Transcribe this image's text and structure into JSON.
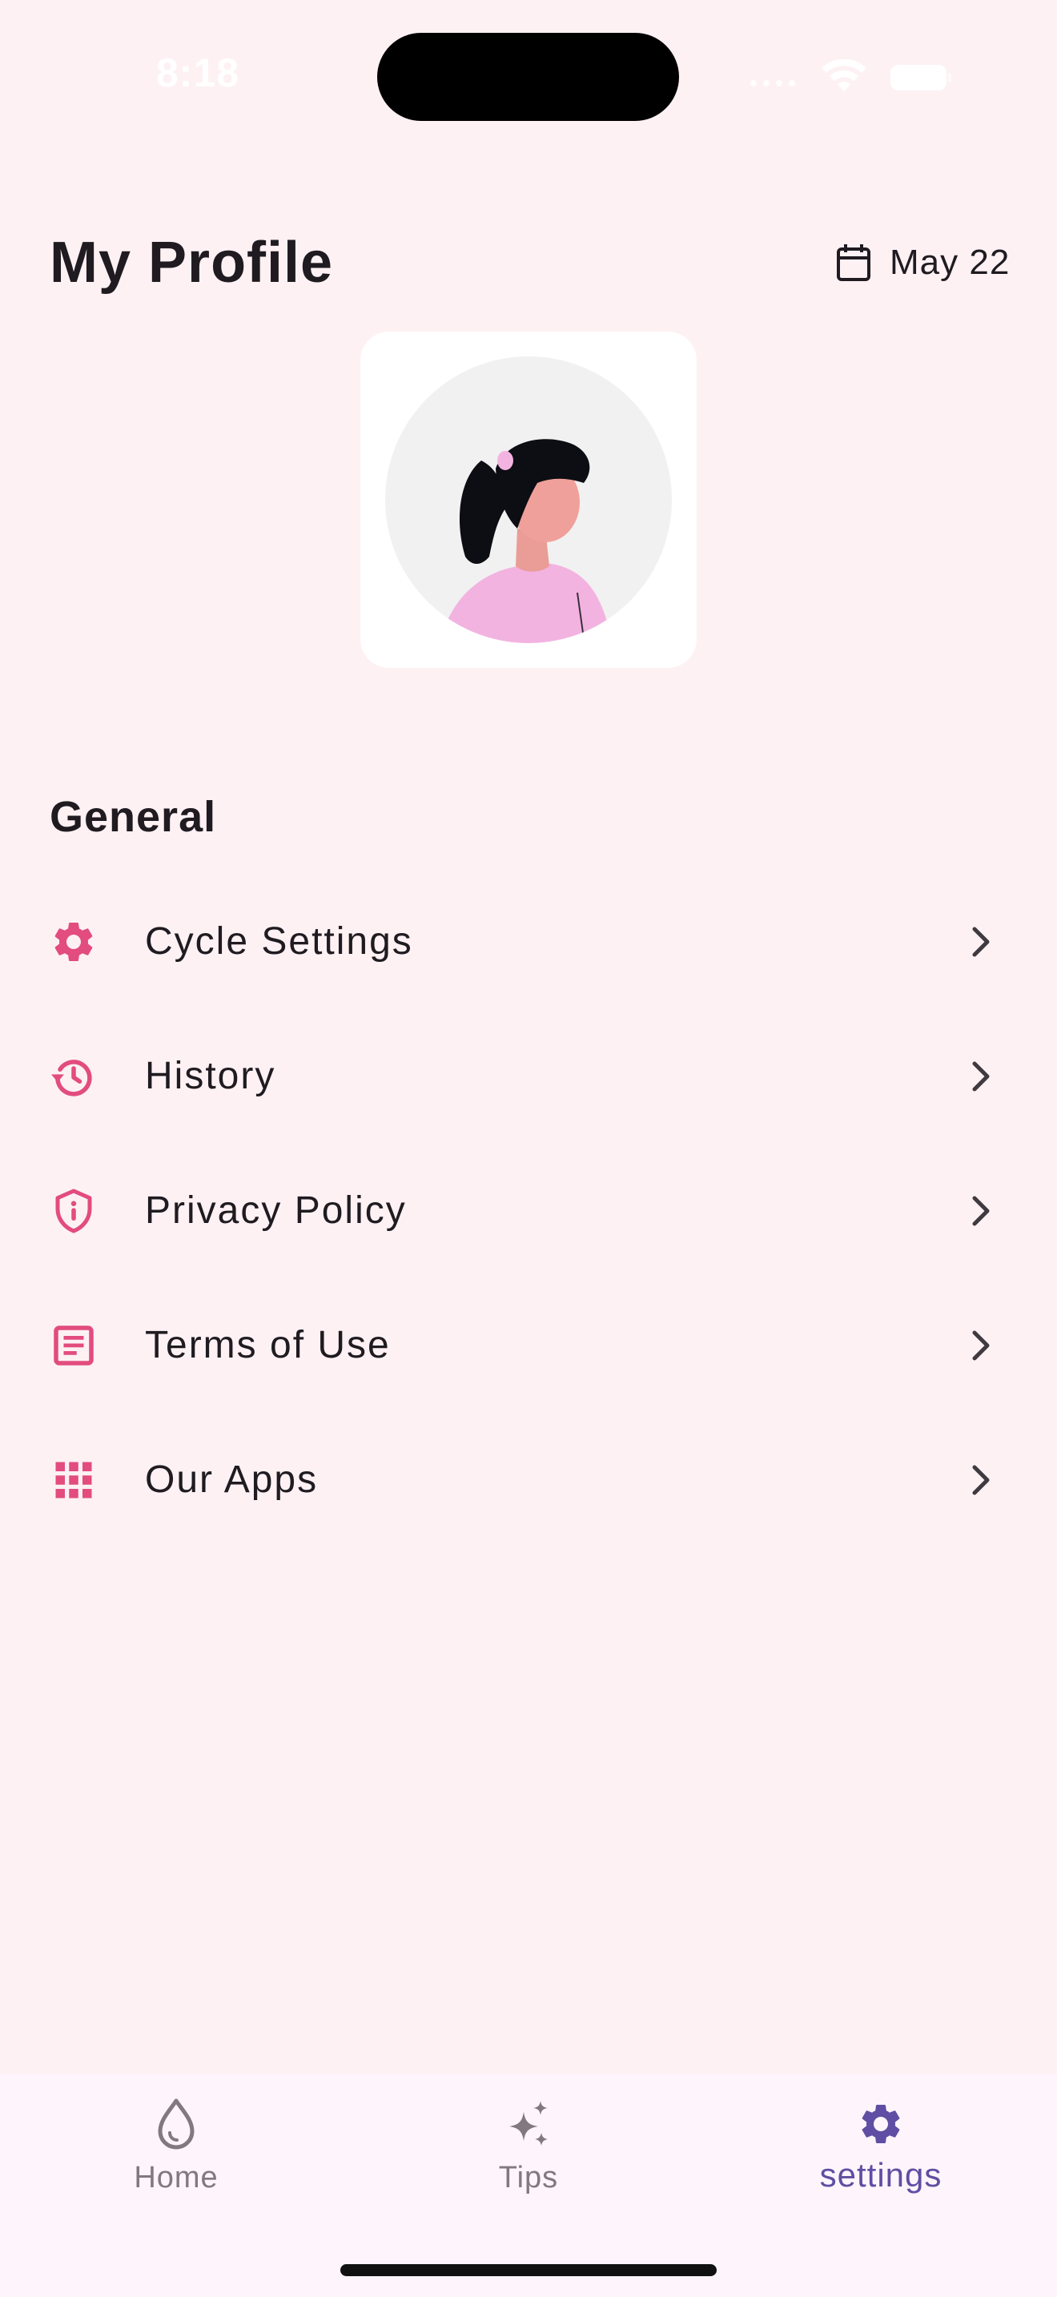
{
  "status_bar": {
    "time": "8:18"
  },
  "header": {
    "title": "My Profile",
    "date": "May 22",
    "date_icon": "calendar-icon"
  },
  "avatar": {
    "illustration": "woman-avatar"
  },
  "general": {
    "title": "General",
    "items": [
      {
        "label": "Cycle Settings",
        "icon": "gear-icon"
      },
      {
        "label": "History",
        "icon": "history-icon"
      },
      {
        "label": "Privacy Policy",
        "icon": "shield-info-icon"
      },
      {
        "label": "Terms of Use",
        "icon": "document-icon"
      },
      {
        "label": "Our Apps",
        "icon": "apps-grid-icon"
      }
    ]
  },
  "bottom_nav": {
    "items": [
      {
        "label": "Home",
        "icon": "drop-icon"
      },
      {
        "label": "Tips",
        "icon": "sparkle-icon"
      },
      {
        "label": "settings",
        "icon": "gear-icon",
        "active": true
      }
    ]
  },
  "colors": {
    "background": "#fdf1f4",
    "accent_pink": "#e24c7f",
    "active_nav": "#5f4ea3",
    "inactive_nav": "#817880",
    "text": "#1f1b20"
  }
}
